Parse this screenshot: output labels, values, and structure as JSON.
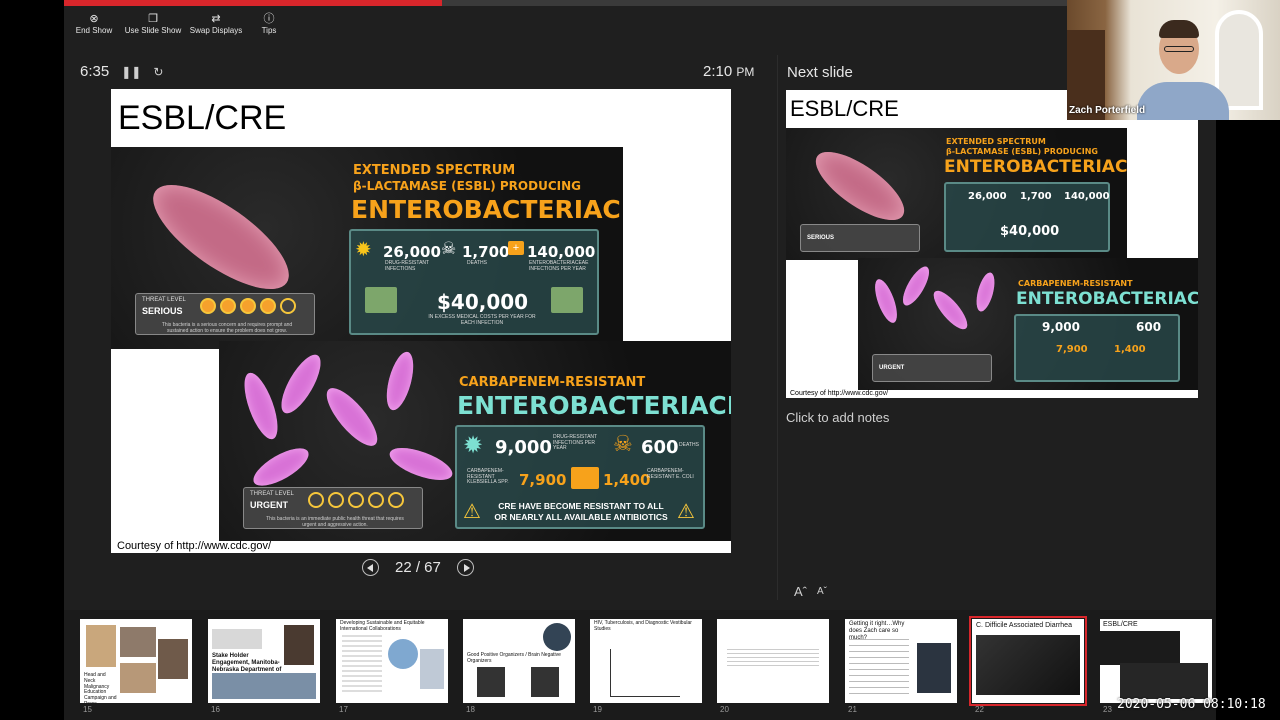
{
  "toolbar": {
    "end_show": "End Show",
    "use_slide_show": "Use Slide Show",
    "swap_displays": "Swap Displays",
    "tips": "Tips"
  },
  "presenter": {
    "elapsed": "6:35",
    "clock": "2:10",
    "clock_suffix": "PM",
    "progress_fraction": 0.377
  },
  "current_slide": {
    "title": "ESBL/CRE",
    "credit": "Courtesy of http://www.cdc.gov/",
    "esbl": {
      "heading_small_1": "EXTENDED SPECTRUM",
      "heading_small_2": "β-LACTAMASE (ESBL) PRODUCING",
      "heading_big": "ENTEROBACTERIACEAE",
      "stat1": "26,000",
      "stat1_label": "DRUG-RESISTANT INFECTIONS",
      "stat2": "1,700",
      "stat2_label": "DEATHS",
      "stat3": "140,000",
      "stat3_label": "ENTEROBACTERIACEAE INFECTIONS PER YEAR",
      "cost": "$40,000",
      "cost_label": "IN EXCESS MEDICAL COSTS PER YEAR FOR EACH INFECTION",
      "threat_label": "THREAT LEVEL",
      "threat_level": "SERIOUS",
      "threat_desc": "This bacteria is a serious concern and requires prompt and sustained action to ensure the problem does not grow."
    },
    "cre": {
      "heading_small": "CARBAPENEM-RESISTANT",
      "heading_big": "ENTEROBACTERIACEAE",
      "stat1": "9,000",
      "stat1_label": "DRUG-RESISTANT INFECTIONS PER YEAR",
      "stat2": "600",
      "stat2_label": "DEATHS",
      "stat3": "7,900",
      "stat3_label": "CARBAPENEM-RESISTANT KLEBSIELLA SPP.",
      "stat4": "1,400",
      "stat4_label": "CARBAPENEM-RESISTANT E. COLI",
      "warning": "CRE HAVE BECOME RESISTANT TO ALL OR NEARLY ALL AVAILABLE ANTIBIOTICS",
      "threat_label": "THREAT LEVEL",
      "threat_level": "URGENT",
      "threat_desc": "This bacteria is an immediate public health threat that requires urgent and aggressive action."
    }
  },
  "navigation": {
    "counter": "22 / 67"
  },
  "next_slide": {
    "label": "Next slide",
    "title": "ESBL/CRE",
    "credit": "Courtesy of http://www.cdc.gov/"
  },
  "notes": {
    "placeholder": "Click to add notes"
  },
  "font_controls": {
    "increase": "Aˆ",
    "decrease": "Aˇ"
  },
  "webcam": {
    "name": "Zach Porterfield"
  },
  "filmstrip": [
    {
      "num": "15",
      "text": "Head and Neck Malignancy Education Campaign and Press Conference"
    },
    {
      "num": "16",
      "text": "Stake Holder Engagement, Manitoba-Nebraska Department of Health"
    },
    {
      "num": "17",
      "text": "Developing Sustainable and Equitable International Collaborations"
    },
    {
      "num": "18",
      "text": "Good Positive Organizers / Brain Negative Organizers"
    },
    {
      "num": "19",
      "text": "HIV, Tuberculosis, and Diagnostic Vestibular Studies"
    },
    {
      "num": "20",
      "text": ""
    },
    {
      "num": "21",
      "text": "Getting it right…Why does Zach care so much?"
    },
    {
      "num": "22",
      "text": "C. Difficile Associated Diarrhea"
    },
    {
      "num": "23",
      "text": "ESBL/CRE"
    }
  ],
  "timestamp": "2020-05-06 08:10:18",
  "colors": {
    "accent": "#d8262b",
    "background": "#1f1f1f",
    "cdc_orange": "#f7a21b",
    "cdc_teal": "#7de0d2"
  }
}
